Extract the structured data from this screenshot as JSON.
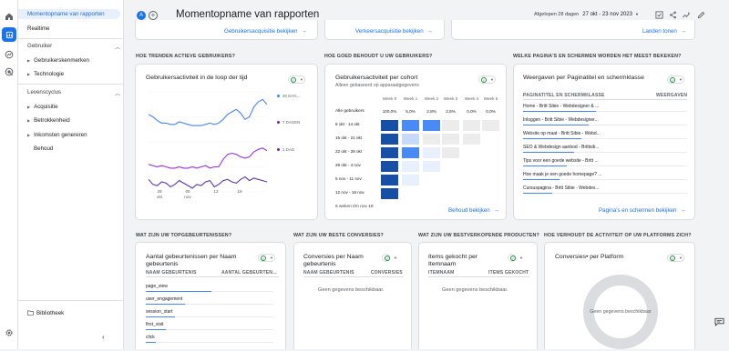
{
  "rail": {
    "icons": [
      "home-icon",
      "reports-icon",
      "explore-icon",
      "advertising-icon",
      "settings-icon"
    ]
  },
  "nav": {
    "snapshot": "Momentopname van rapporten",
    "realtime": "Realtime",
    "user_section": "Gebruiker",
    "user_items": [
      "Gebruikerskenmerken",
      "Technologie"
    ],
    "lifecycle_section": "Levenscyclus",
    "lifecycle_items": [
      "Acquisitie",
      "Betrokkenheid",
      "Inkomsten genereren",
      "Behoud"
    ],
    "library": "Bibliotheek"
  },
  "topbar": {
    "avatar": "A",
    "title": "Momentopname van rapporten",
    "date_label": "Afgelopen 28 dagen",
    "date_value": "27 okt - 23 nov 2023"
  },
  "top_links": [
    "Gebruikersacquisitie bekijken",
    "Verkeersacquisitie bekijken",
    "Landen tonen"
  ],
  "sections": {
    "q1": "HOE TRENDEN ACTIEVE GEBRUIKERS?",
    "q2": "HOE GOED BEHOUDT U UW GEBRUIKERS?",
    "q3": "WELKE PAGINA'S EN SCHERMEN WORDEN HET MEEST BEKEKEN?",
    "q4": "WAT ZIJN UW TOPGEBEURTENISSEN?",
    "q5": "WAT ZIJN UW BESTE CONVERSIES?",
    "q6": "WAT ZIJN UW BESTVERKOPENDE PRODUCTEN?",
    "q7": "HOE VERHOUDT DE ACTIVITEIT OP UW PLATFORMS ZICH?"
  },
  "activity": {
    "title": "Gebruikersactiviteit in de loop der tijd",
    "legend": [
      "30 DAG...",
      "7 DAGEN",
      "1 DAG"
    ],
    "colors": [
      "#4285f4",
      "#7b1fa2",
      "#7b1fa2"
    ],
    "xticks": [
      "29\nokt",
      "05\nnov",
      "12",
      "19"
    ]
  },
  "chart_data": {
    "type": "line",
    "x": [
      "27 okt",
      "28 okt",
      "29 okt",
      "30 okt",
      "31 okt",
      "1 nov",
      "2 nov",
      "3 nov",
      "4 nov",
      "5 nov",
      "6 nov",
      "7 nov",
      "8 nov",
      "9 nov",
      "10 nov",
      "11 nov",
      "12 nov",
      "13 nov",
      "14 nov",
      "15 nov",
      "16 nov",
      "17 nov",
      "18 nov",
      "19 nov",
      "20 nov",
      "21 nov",
      "22 nov",
      "23 nov"
    ],
    "series": [
      {
        "name": "30 DAG...",
        "values": [
          62,
          60,
          57,
          55,
          55,
          54,
          54,
          56,
          55,
          54,
          53,
          53,
          53,
          54,
          55,
          54,
          55,
          58,
          62,
          64,
          66,
          63,
          58,
          60,
          68,
          72,
          74,
          70
        ]
      },
      {
        "name": "7 DAGEN",
        "values": [
          22,
          21,
          20,
          21,
          20,
          19,
          19,
          20,
          19,
          19,
          20,
          19,
          20,
          21,
          19,
          20,
          20,
          26,
          30,
          31,
          30,
          28,
          27,
          28,
          32,
          34,
          35,
          33
        ]
      },
      {
        "name": "1 DAG",
        "values": [
          10,
          6,
          5,
          8,
          7,
          4,
          6,
          9,
          7,
          5,
          3,
          6,
          5,
          8,
          9,
          4,
          6,
          9,
          10,
          8,
          7,
          10,
          12,
          9,
          11,
          10,
          9,
          8
        ]
      }
    ],
    "ylim": [
      0,
      80
    ]
  },
  "cohort": {
    "title": "Gebruikersactiviteit per cohort",
    "subtitle": "Alleen gebaseerd op apparaatgegevens",
    "weeks": [
      "Week 0",
      "Week 1",
      "Week 2",
      "Week 3",
      "Week 4",
      "Week 5"
    ],
    "header_row": {
      "label": "Alle gebruikers",
      "values": [
        "100,0%",
        "5,0%",
        "2,8%",
        "2,5%",
        "0,0%",
        "0,0%"
      ]
    },
    "rows": [
      {
        "label": "8 okt - 14 okt",
        "levels": [
          1.0,
          0.35,
          0.3,
          0,
          0,
          0
        ]
      },
      {
        "label": "15 okt - 21 okt",
        "levels": [
          1.0,
          0.1,
          0,
          0,
          0,
          null
        ]
      },
      {
        "label": "22 okt - 28 okt",
        "levels": [
          1.0,
          0.3,
          0.05,
          0,
          null,
          null
        ]
      },
      {
        "label": "29 okt - 4 nov",
        "levels": [
          1.0,
          0.05,
          0.05,
          null,
          null,
          null
        ]
      },
      {
        "label": "5 nov - 11 nov",
        "levels": [
          1.0,
          0.05,
          null,
          null,
          null,
          null
        ]
      },
      {
        "label": "12 nov - 18 nov",
        "levels": [
          1.0,
          null,
          null,
          null,
          null,
          null
        ]
      }
    ],
    "footer": "6 weken t/m nov 18",
    "link": "Behoud bekijken"
  },
  "pages": {
    "title": "Weergaven per Paginatitel en schermklasse",
    "col1": "PAGINATITEL EN SCHERMKLASSE",
    "col2": "WEERGAVEN",
    "rows": [
      "Home - Britt Sibie - Webdesigner & ...",
      "Inloggen - Britt Sibie - Webdesigner...",
      "Website op maat - Britt Sibie - Webd...",
      "SEO & Webdesign aanbod - Brittsib...",
      "Tips voor een goede website - Britt ...",
      "Hoe maak je een goede homepage? ...",
      "Cursuspagina - Britt Sibie - Webdes..."
    ],
    "link": "Pagina's en schermen bekijken"
  },
  "events": {
    "title": "Aantal gebeurtenissen per Naam gebeurtenis",
    "col1": "NAAM GEBEURTENIS",
    "col2": "AANTAL GEBEURTEN...",
    "rows": [
      "page_view",
      "user_engagement",
      "session_start",
      "first_visit",
      "click"
    ],
    "bar_share": [
      1.0,
      0.6,
      0.45,
      0.3,
      0.15
    ]
  },
  "conversions": {
    "title": "Conversies per Naam gebeurtenis",
    "col1": "NAAM GEBEURTENIS",
    "col2": "CONVERSIES",
    "empty": "Geen gegevens beschikbaar."
  },
  "products": {
    "title": "Items gekocht per Itemnaam",
    "col1": "ITEMNAAM",
    "col2": "ITEMS GEKOCHT",
    "empty": "Geen gegevens beschikbaar."
  },
  "platform": {
    "title": "Conversies• per Platform",
    "empty": "Geen gegevens beschikbaar"
  }
}
